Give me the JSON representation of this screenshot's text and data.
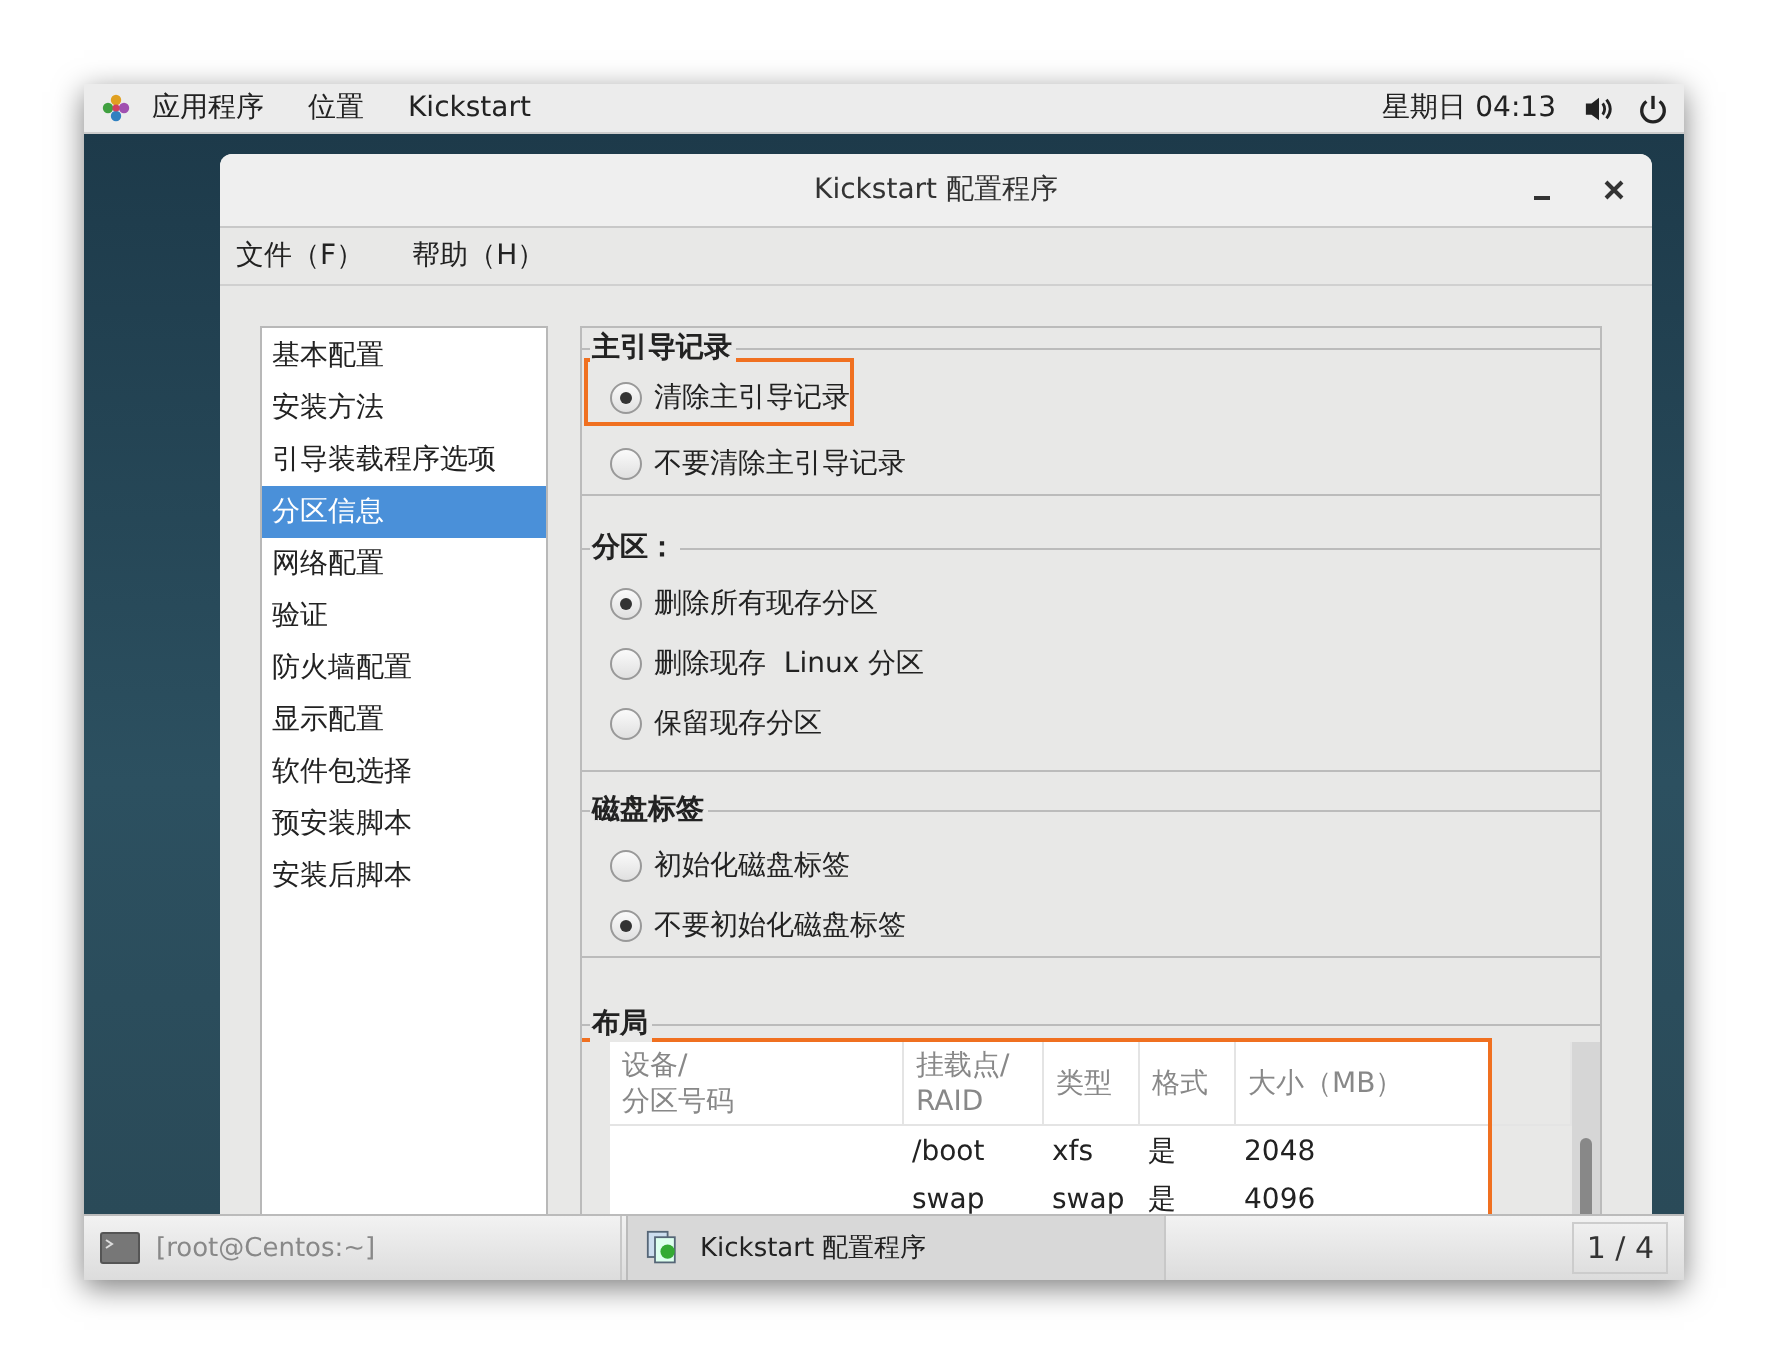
{
  "top_bar": {
    "menus": [
      "应用程序",
      "位置",
      "Kickstart"
    ],
    "clock": "星期日 04:13"
  },
  "window": {
    "title": "Kickstart 配置程序",
    "menu": [
      "文件（F）",
      "帮助（H）"
    ]
  },
  "sidebar": {
    "items": [
      {
        "label": "基本配置",
        "selected": false
      },
      {
        "label": "安装方法",
        "selected": false
      },
      {
        "label": "引导装载程序选项",
        "selected": false
      },
      {
        "label": "分区信息",
        "selected": true
      },
      {
        "label": "网络配置",
        "selected": false
      },
      {
        "label": "验证",
        "selected": false
      },
      {
        "label": "防火墙配置",
        "selected": false
      },
      {
        "label": "显示配置",
        "selected": false
      },
      {
        "label": "软件包选择",
        "selected": false
      },
      {
        "label": "预安装脚本",
        "selected": false
      },
      {
        "label": "安装后脚本",
        "selected": false
      }
    ]
  },
  "sections": [
    {
      "title": "主引导记录",
      "kind": "radio",
      "options": [
        {
          "label": "清除主引导记录",
          "selected": true,
          "highlighted": true
        },
        {
          "label": "不要清除主引导记录",
          "selected": false,
          "highlighted": false
        }
      ]
    },
    {
      "title": "分区：",
      "kind": "radio",
      "options": [
        {
          "label": "删除所有现存分区",
          "selected": true,
          "highlighted": false
        },
        {
          "label": "删除现存  Linux 分区",
          "selected": false,
          "highlighted": false
        },
        {
          "label": "保留现存分区",
          "selected": false,
          "highlighted": false
        }
      ]
    },
    {
      "title": "磁盘标签",
      "kind": "radio",
      "options": [
        {
          "label": "初始化磁盘标签",
          "selected": false,
          "highlighted": false
        },
        {
          "label": "不要初始化磁盘标签",
          "selected": true,
          "highlighted": false
        }
      ]
    },
    {
      "title": "布局",
      "kind": "table",
      "highlighted": true,
      "columns": [
        "设备/\n分区号码",
        "挂载点/\nRAID",
        "类型",
        "格式",
        "大小（MB）"
      ],
      "rows": [
        {
          "mount": "/boot",
          "type": "xfs",
          "format": "是",
          "size": "2048"
        },
        {
          "mount": "swap",
          "type": "swap",
          "format": "是",
          "size": "4096"
        }
      ]
    }
  ],
  "taskbar": {
    "windows": [
      {
        "label": "[root@Centos:~]",
        "selected": false
      },
      {
        "label": "Kickstart 配置程序",
        "selected": true
      }
    ],
    "workspace": "1 / 4"
  }
}
